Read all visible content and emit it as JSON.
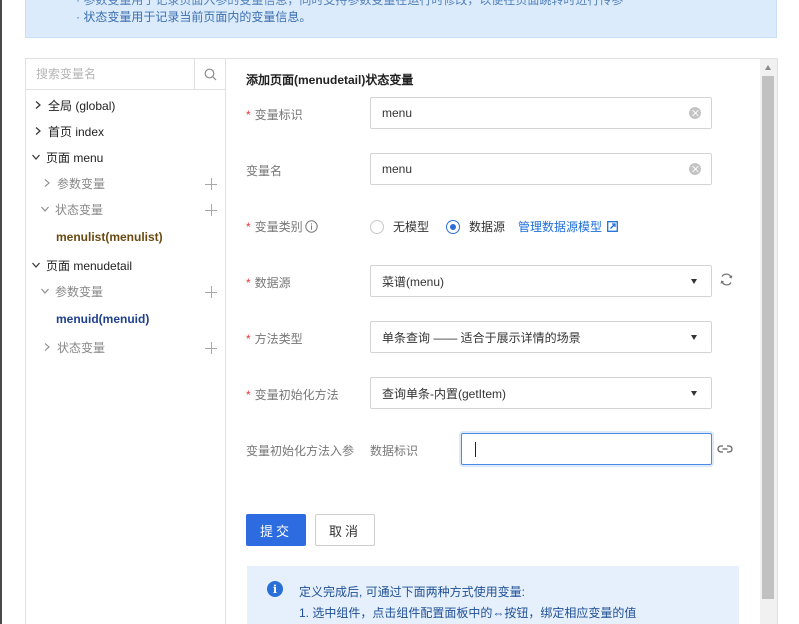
{
  "notice": {
    "line1": "· 参数变量用于记录页面入参的变量信息，同时支持参数变量在运行时修改，以便在页面跳转时进行传参",
    "line2": "· 状态变量用于记录当前页面内的变量信息。"
  },
  "sidebar": {
    "search_placeholder": "搜索变量名",
    "tree": {
      "global": "全局 (global)",
      "home": "首页 index",
      "menu_page": "页面 menu",
      "menu_params": "参数变量",
      "menu_state": "状态变量",
      "menu_state_var": "menulist(menulist)",
      "detail_page": "页面 menudetail",
      "detail_params": "参数变量",
      "detail_params_var": "menuid(menuid)",
      "detail_state": "状态变量"
    }
  },
  "form": {
    "title": "添加页面(menudetail)状态变量",
    "var_id_label": "变量标识",
    "var_id_value": "menu",
    "var_name_label": "变量名",
    "var_name_value": "menu",
    "var_type_label": "变量类别",
    "radio_no_model": "无模型",
    "radio_datasource": "数据源",
    "manage_link": "管理数据源模型",
    "datasource_label": "数据源",
    "datasource_value": "菜谱(menu)",
    "method_type_label": "方法类型",
    "method_type_value": "单条查询 —— 适合于展示详情的场景",
    "init_method_label": "变量初始化方法",
    "init_method_value": "查询单条-内置(getItem)",
    "init_param_label": "变量初始化方法入参",
    "param_key": "数据标识",
    "submit": "提交",
    "cancel": "取消"
  },
  "tip": {
    "line1": "定义完成后, 可通过下面两种方式使用变量:",
    "line2": "1. 选中组件，点击组件配置面板中的⇔按钮，绑定相应变量的值"
  },
  "colors": {
    "accent": "#2c6be0",
    "required": "#e13c3c",
    "notice_bg": "#dcebfb",
    "tip_bg": "#e5f0fc"
  }
}
